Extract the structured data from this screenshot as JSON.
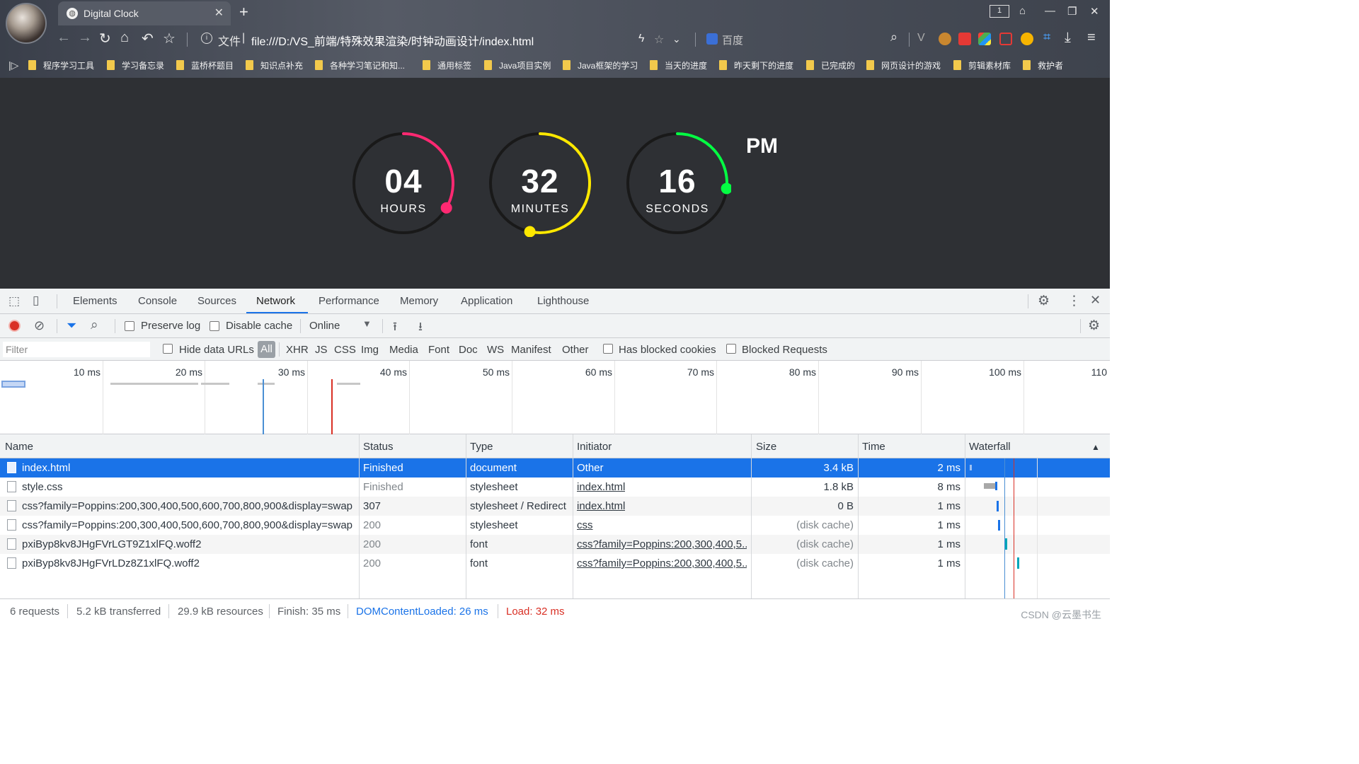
{
  "browser": {
    "tab_title": "Digital Clock",
    "new_tab_symbol": "+",
    "address_prefix": "文件",
    "url": "file:///D:/VS_前端/特殊效果渲染/时钟动画设计/index.html",
    "search_engine": "百度",
    "window_badge": "1",
    "bookmarks": [
      "程序学习工具",
      "学习备忘录",
      "蓝桥杯题目",
      "知识点补充",
      "各种学习笔记和知...",
      "通用标签",
      "Java项目实例",
      "Java框架的学习",
      "当天的进度",
      "昨天剩下的进度",
      "已完成的",
      "网页设计的游戏",
      "剪辑素材库",
      "救护者"
    ]
  },
  "clock": {
    "hours": {
      "value": "04",
      "label": "HOURS",
      "color": "#ff2972",
      "fraction": 0.333
    },
    "minutes": {
      "value": "32",
      "label": "MINUTES",
      "color": "#fee800",
      "fraction": 0.533
    },
    "seconds": {
      "value": "16",
      "label": "SECONDS",
      "color": "#04fc43",
      "fraction": 0.267
    },
    "ampm": "PM"
  },
  "devtools": {
    "tabs": [
      "Elements",
      "Console",
      "Sources",
      "Network",
      "Performance",
      "Memory",
      "Application",
      "Lighthouse"
    ],
    "active_tab": "Network",
    "toolbar": {
      "preserve_log": "Preserve log",
      "disable_cache": "Disable cache",
      "throttle": "Online"
    },
    "filter": {
      "placeholder": "Filter",
      "hide_data_urls": "Hide data URLs",
      "all": "All",
      "types": [
        "XHR",
        "JS",
        "CSS",
        "Img",
        "Media",
        "Font",
        "Doc",
        "WS",
        "Manifest",
        "Other"
      ],
      "has_blocked_cookies": "Has blocked cookies",
      "blocked_requests": "Blocked Requests"
    },
    "overview_ticks": [
      "10 ms",
      "20 ms",
      "30 ms",
      "40 ms",
      "50 ms",
      "60 ms",
      "70 ms",
      "80 ms",
      "90 ms",
      "100 ms",
      "110"
    ],
    "columns": [
      "Name",
      "Status",
      "Type",
      "Initiator",
      "Size",
      "Time",
      "Waterfall"
    ],
    "rows": [
      {
        "name": "index.html",
        "status": "Finished",
        "type": "document",
        "initiator": "Other",
        "size": "3.4 kB",
        "time": "2 ms"
      },
      {
        "name": "style.css",
        "status": "Finished",
        "type": "stylesheet",
        "initiator": "index.html",
        "size": "1.8 kB",
        "time": "8 ms"
      },
      {
        "name": "css?family=Poppins:200,300,400,500,600,700,800,900&display=swap",
        "status": "307",
        "type": "stylesheet / Redirect",
        "initiator": "index.html",
        "size": "0 B",
        "time": "1 ms"
      },
      {
        "name": "css?family=Poppins:200,300,400,500,600,700,800,900&display=swap",
        "status": "200",
        "type": "stylesheet",
        "initiator": "css",
        "size": "(disk cache)",
        "time": "1 ms"
      },
      {
        "name": "pxiByp8kv8JHgFVrLGT9Z1xlFQ.woff2",
        "status": "200",
        "type": "font",
        "initiator": "css?family=Poppins:200,300,400,5...",
        "size": "(disk cache)",
        "time": "1 ms"
      },
      {
        "name": "pxiByp8kv8JHgFVrLDz8Z1xlFQ.woff2",
        "status": "200",
        "type": "font",
        "initiator": "css?family=Poppins:200,300,400,5...",
        "size": "(disk cache)",
        "time": "1 ms"
      }
    ],
    "status": {
      "requests": "6 requests",
      "transferred": "5.2 kB transferred",
      "resources": "29.9 kB resources",
      "finish": "Finish: 35 ms",
      "dcl": "DOMContentLoaded: 26 ms",
      "load": "Load: 32 ms"
    },
    "watermark": "CSDN @云墨书生"
  }
}
